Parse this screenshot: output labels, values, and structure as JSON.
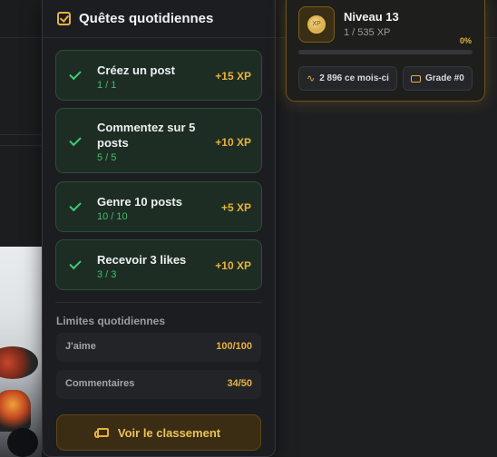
{
  "quests_panel": {
    "title": "Quêtes quotidiennes",
    "quests": [
      {
        "name": "Créez un post",
        "progress": "1 / 1",
        "xp": "+15 XP"
      },
      {
        "name": "Commentez sur 5 posts",
        "progress": "5 / 5",
        "xp": "+10 XP"
      },
      {
        "name": "Genre 10 posts",
        "progress": "10 / 10",
        "xp": "+5 XP"
      },
      {
        "name": "Recevoir 3 likes",
        "progress": "3 / 3",
        "xp": "+10 XP"
      }
    ],
    "limits": {
      "title": "Limites quotidiennes",
      "rows": [
        {
          "label": "J'aime",
          "value": "100/100"
        },
        {
          "label": "Commentaires",
          "value": "34/50"
        }
      ]
    },
    "leaderboard_button": "Voir le classement"
  },
  "level_card": {
    "badge_text": "XP",
    "level": "Niveau 13",
    "xp": "1 / 535 XP",
    "progress_percent": "0%",
    "progress_fraction": 0.0,
    "stats": [
      {
        "icon": "activity-icon",
        "text": "2 896 ce mois-ci"
      },
      {
        "icon": "trophy-icon",
        "text": "Grade #0"
      }
    ]
  },
  "colors": {
    "accent_gold": "#e6b23c",
    "success_green": "#3fbf6e",
    "panel_bg": "#1c1d20",
    "quest_bg": "#1d2d24"
  }
}
